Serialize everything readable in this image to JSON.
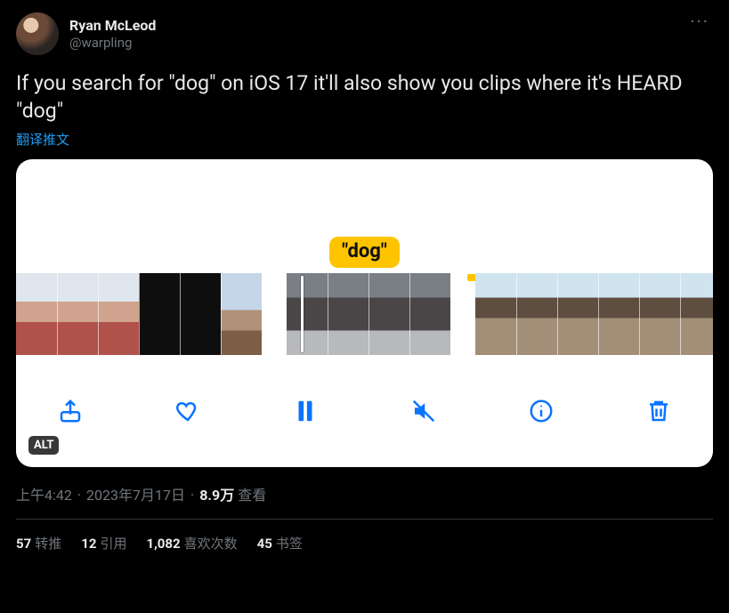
{
  "author": {
    "display_name": "Ryan McLeod",
    "handle": "@warpling"
  },
  "tweet_text": "If you search for \"dog\" on iOS 17 it'll also show you clips where it's HEARD \"dog\"",
  "translate_label": "翻译推文",
  "media": {
    "badge_text": "\"dog\"",
    "alt_label": "ALT",
    "toolbar_icons": [
      "share",
      "heart",
      "pause",
      "mute",
      "info",
      "trash"
    ]
  },
  "meta": {
    "time": "上午4:42",
    "date": "2023年7月17日",
    "separator": "·",
    "views_count": "8.9万",
    "views_label": "查看"
  },
  "stats": {
    "retweets": {
      "count": "57",
      "label": "转推"
    },
    "quotes": {
      "count": "12",
      "label": "引用"
    },
    "likes": {
      "count": "1,082",
      "label": "喜欢次数"
    },
    "bookmarks": {
      "count": "45",
      "label": "书签"
    }
  },
  "more_glyph": "···"
}
